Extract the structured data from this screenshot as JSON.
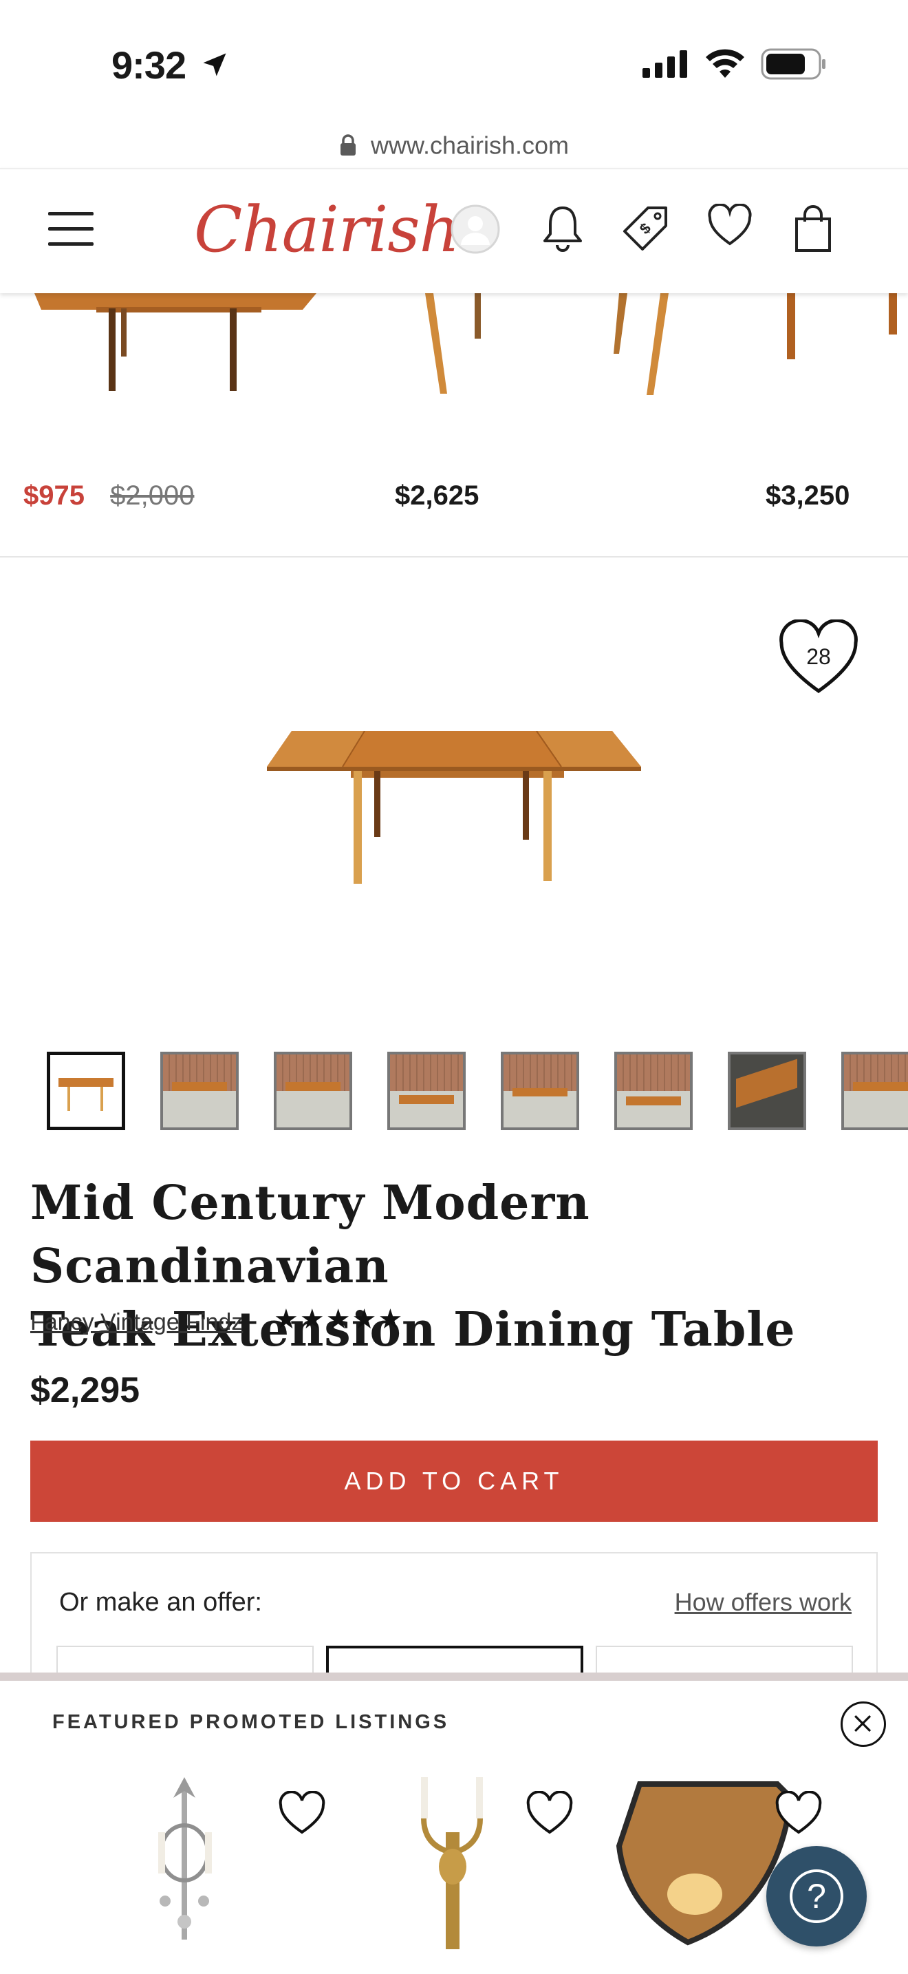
{
  "status_bar": {
    "time": "9:32"
  },
  "browser": {
    "url": "www.chairish.com"
  },
  "header": {
    "logo": "Chairish"
  },
  "related": {
    "items": [
      {
        "price": "$975",
        "original_price": "$2,000"
      },
      {
        "price": "$2,625"
      },
      {
        "price": "$3,250"
      }
    ]
  },
  "product": {
    "favorite_count": "28",
    "title_line1": "Mid Century Modern Scandinavian",
    "title_line2": "Teak Extension Dining Table",
    "seller": "Fancy Vintage Findz",
    "rating_stars": "★★★★★",
    "price": "$2,295",
    "add_to_cart": "ADD TO CART"
  },
  "offer": {
    "label": "Or make an offer:",
    "link": "How offers work"
  },
  "promo": {
    "heading": "FEATURED PROMOTED LISTINGS"
  },
  "colors": {
    "brand": "#c8423a",
    "cta": "#cc4638",
    "help": "#2f5069"
  }
}
